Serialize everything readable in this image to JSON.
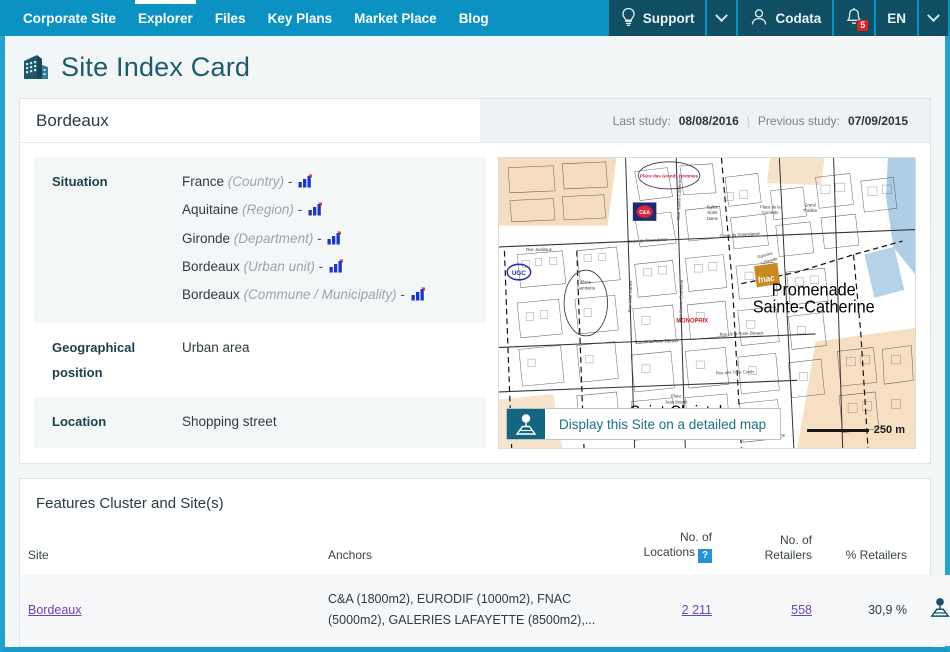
{
  "nav": {
    "items": [
      {
        "label": "Corporate Site",
        "active": false
      },
      {
        "label": "Explorer",
        "active": true
      },
      {
        "label": "Files",
        "active": false
      },
      {
        "label": "Key Plans",
        "active": false
      },
      {
        "label": "Market Place",
        "active": false
      },
      {
        "label": "Blog",
        "active": false
      }
    ],
    "support_label": "Support",
    "account_label": "Codata",
    "notification_count": "5",
    "language_label": "EN"
  },
  "page": {
    "title": "Site Index Card"
  },
  "site_card": {
    "name": "Bordeaux",
    "last_study_label": "Last study:",
    "last_study_value": "08/08/2016",
    "separator": "|",
    "previous_study_label": "Previous study:",
    "previous_study_value": "07/09/2015",
    "rows": [
      {
        "label": "Situation",
        "lines": [
          {
            "name": "France",
            "kind": "(Country)"
          },
          {
            "name": "Aquitaine",
            "kind": "(Region)"
          },
          {
            "name": "Gironde",
            "kind": "(Department)"
          },
          {
            "name": "Bordeaux",
            "kind": "(Urban unit)"
          },
          {
            "name": "Bordeaux",
            "kind": "(Commune / Municipality)"
          }
        ]
      },
      {
        "label": "Geographical position",
        "value": "Urban area"
      },
      {
        "label": "Location",
        "value": "Shopping street"
      }
    ],
    "map": {
      "cta_label": "Display this Site on a detailed map",
      "scale_label": "250 m",
      "labels": [
        "Promenade",
        "Sainte-Catherine",
        "Saint-Christoly",
        "MONOPRIX",
        "fnac",
        "UGC",
        "Cours de l'Intendance",
        "Place Gambetta",
        "Galeries Lafayette",
        "Eglise Notre Dame",
        "Place de la Comédie",
        "Grand Theatre",
        "Cathédrale St-André",
        "Hôtel de Ville",
        "Rue Sainte-Catherine",
        "Rue des Trois Conils"
      ]
    }
  },
  "features": {
    "title": "Features Cluster and Site(s)",
    "columns": {
      "site": "Site",
      "anchors": "Anchors",
      "locations_l1": "No. of",
      "locations_l2": "Locations",
      "locations_help": "?",
      "retailers_l1": "No. of",
      "retailers_l2": "Retailers",
      "pct_retailers": "% Retailers"
    },
    "rows": [
      {
        "site": "Bordeaux",
        "anchors": "C&A (1800m2), EURODIF (1000m2), FNAC (5000m2), GALERIES LAFAYETTE (8500m2),...",
        "locations": "2 211",
        "retailers": "558",
        "pct_retailers": "30,9 %"
      }
    ]
  },
  "colors": {
    "nav_blue": "#0b92c2",
    "nav_dark": "#0f4e63",
    "title_teal": "#1d5b6e",
    "link_purple": "#6e43b8",
    "badge_red": "#e02020",
    "help_blue": "#2196d6"
  }
}
